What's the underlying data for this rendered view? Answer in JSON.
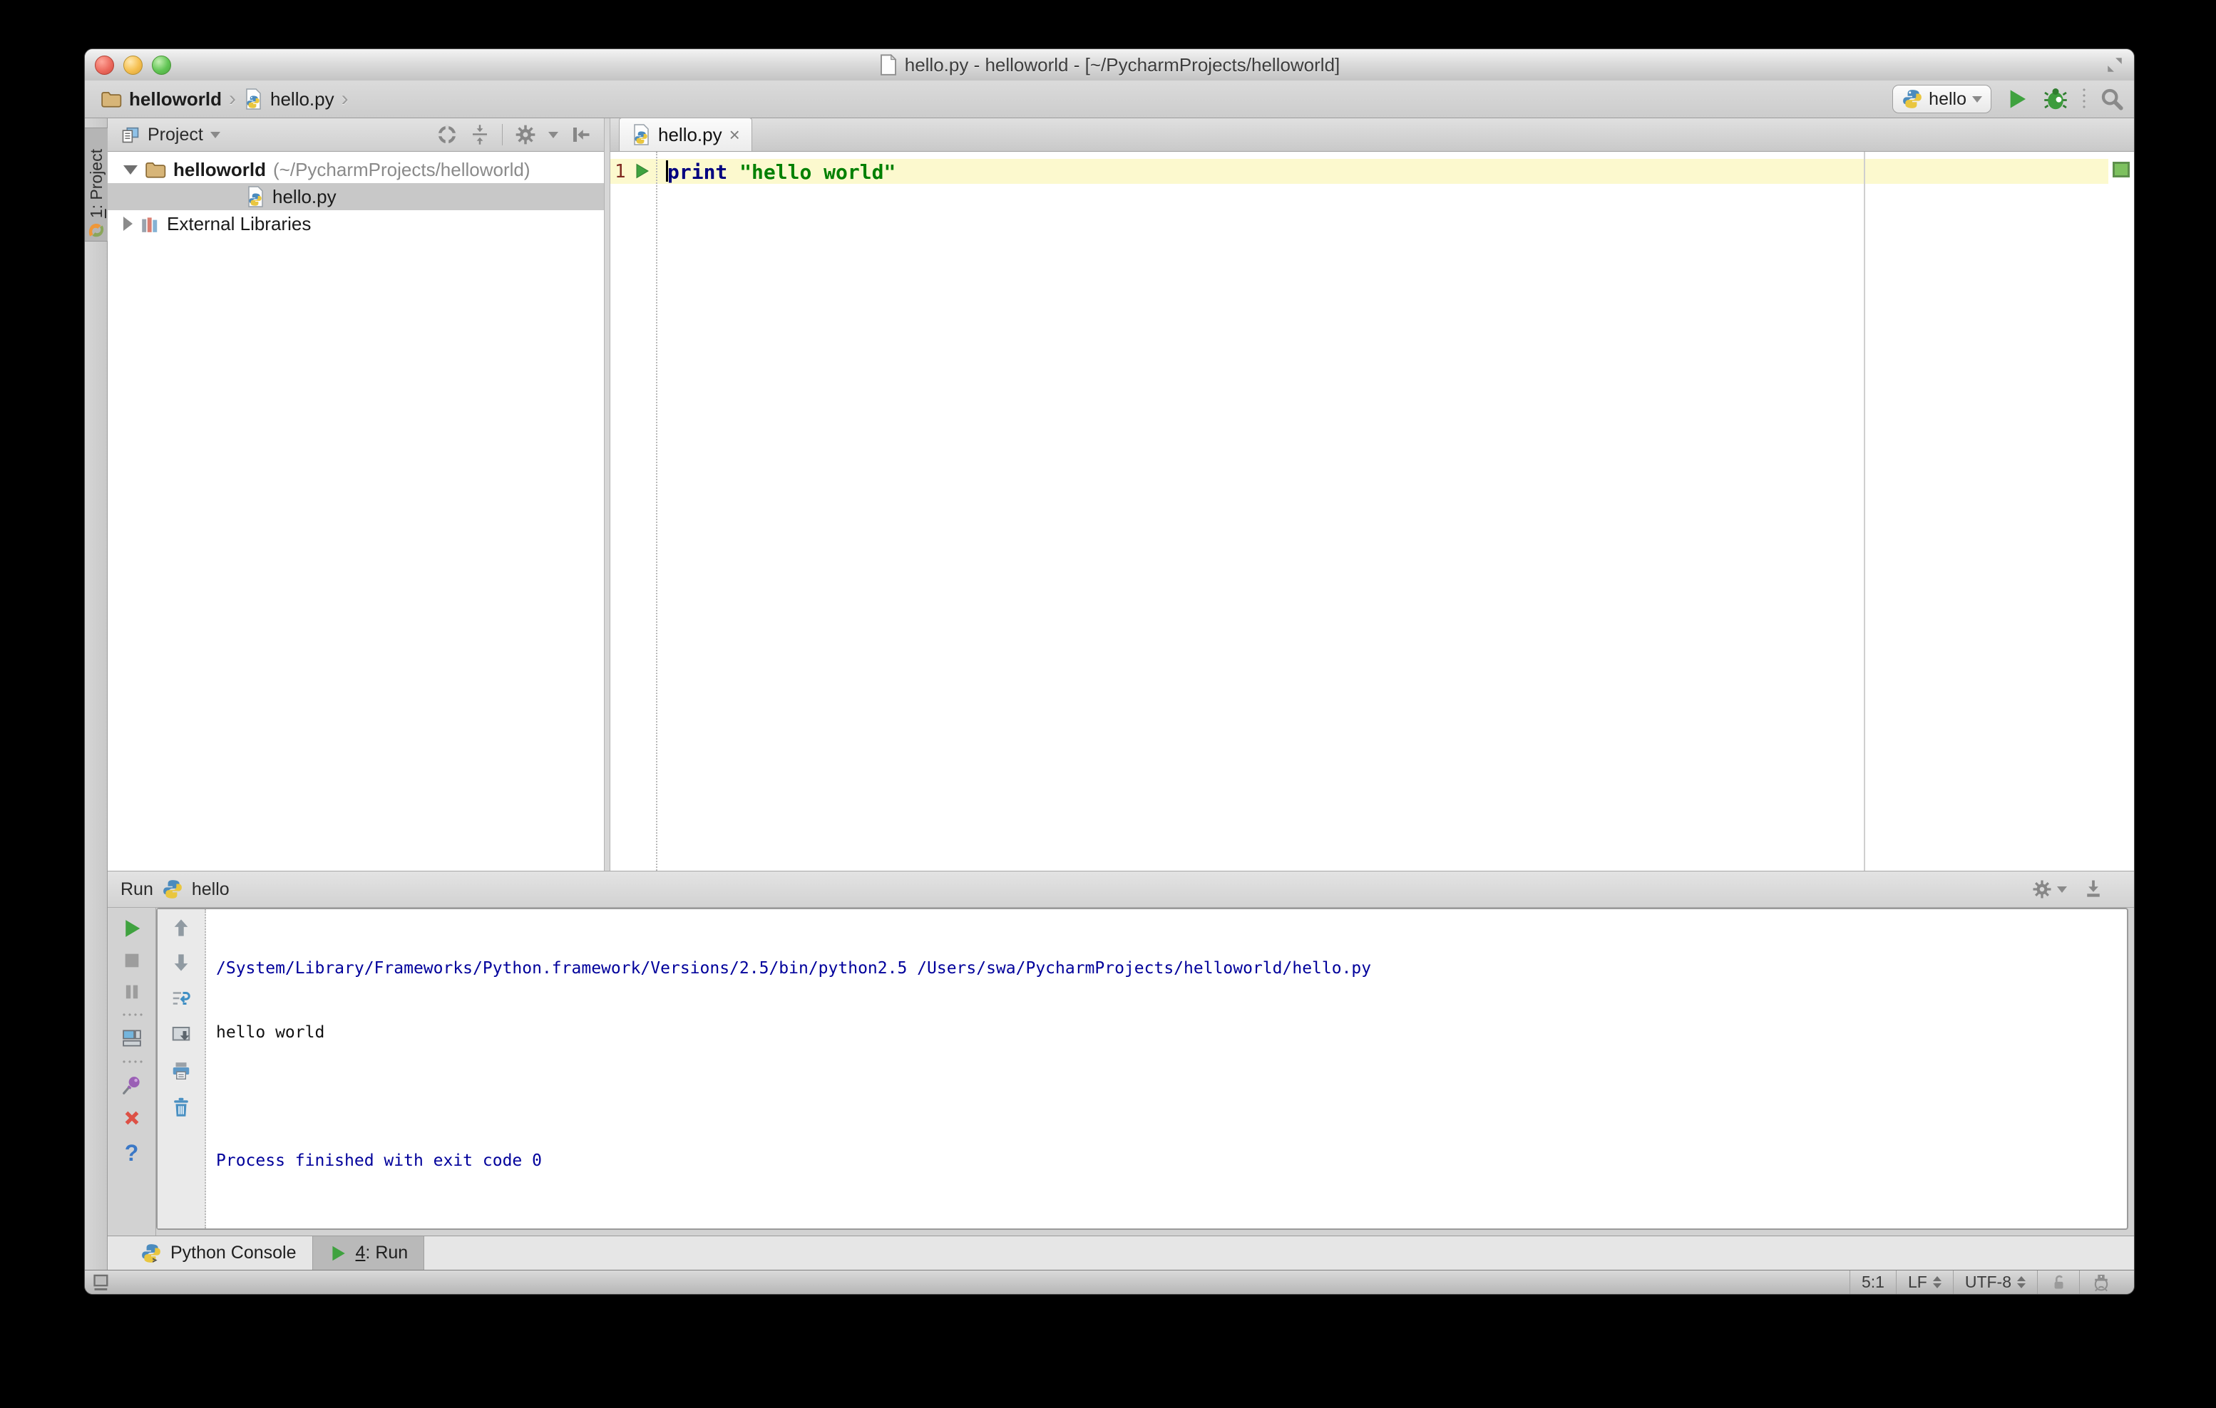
{
  "window": {
    "title": "hello.py - helloworld - [~/PycharmProjects/helloworld]"
  },
  "breadcrumbs": {
    "separator": "›",
    "items": [
      {
        "label": "helloworld"
      },
      {
        "label": "hello.py"
      }
    ]
  },
  "toolbar": {
    "run_config_name": "hello"
  },
  "tool_window_stripe": {
    "project_tab_number": "1",
    "project_tab_rest": ": Project"
  },
  "project_panel": {
    "title": "Project",
    "tree": {
      "root_label": "helloworld",
      "root_path": "(~/PycharmProjects/helloworld)",
      "file_label": "hello.py",
      "libraries_label": "External Libraries"
    }
  },
  "editor": {
    "tab_label": "hello.py",
    "tab_close_glyph": "×",
    "line_number": "1",
    "code_keyword": "print",
    "code_string": "\"hello world\""
  },
  "run_panel": {
    "title": "Run",
    "config_name": "hello",
    "help_glyph": "?",
    "console": {
      "line1": "/System/Library/Frameworks/Python.framework/Versions/2.5/bin/python2.5 /Users/swa/PycharmProjects/helloworld/hello.py",
      "line2": "hello world",
      "line3": "",
      "line4": "Process finished with exit code 0"
    }
  },
  "bottom_bar": {
    "python_console_label": "Python Console",
    "run_tab_number": "4",
    "run_tab_rest": ": Run"
  },
  "status_bar": {
    "caret_position": "5:1",
    "line_separator": "LF",
    "encoding": "UTF-8"
  },
  "colors": {
    "run_green": "#3fa23f",
    "keyword": "#000080",
    "string": "#008000",
    "console_system_text": "#00009b",
    "current_line_highlight": "#fcf9ce",
    "inspection_ok_indicator": "#7dc15f"
  }
}
